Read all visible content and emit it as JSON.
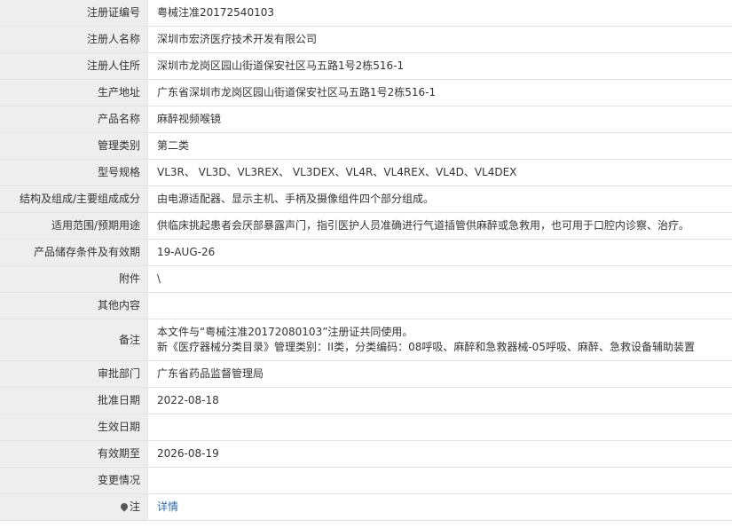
{
  "rows": [
    {
      "label": "注册证编号",
      "value": "粤械注准20172540103"
    },
    {
      "label": "注册人名称",
      "value": "深圳市宏济医疗技术开发有限公司"
    },
    {
      "label": "注册人住所",
      "value": "深圳市龙岗区园山街道保安社区马五路1号2栋516-1"
    },
    {
      "label": "生产地址",
      "value": "广东省深圳市龙岗区园山街道保安社区马五路1号2栋516-1"
    },
    {
      "label": "产品名称",
      "value": "麻醉视频喉镜"
    },
    {
      "label": "管理类别",
      "value": "第二类"
    },
    {
      "label": "型号规格",
      "value": "VL3R、 VL3D、VL3REX、 VL3DEX、VL4R、VL4REX、VL4D、VL4DEX"
    },
    {
      "label": "结构及组成/主要组成成分",
      "value": "由电源适配器、显示主机、手柄及摄像组件四个部分组成。"
    },
    {
      "label": "适用范围/预期用途",
      "value": "供临床挑起患者会厌部暴露声门，指引医护人员准确进行气道插管供麻醉或急救用，也可用于口腔内诊察、治疗。"
    },
    {
      "label": "产品储存条件及有效期",
      "value": "19-AUG-26"
    },
    {
      "label": "附件",
      "value": "\\"
    },
    {
      "label": "其他内容",
      "value": ""
    }
  ],
  "remark": {
    "label": "备注",
    "line1": "本文件与“粤械注准20172080103”注册证共同使用。",
    "line2": "新《医疗器械分类目录》管理类别：II类，分类编码：08呼吸、麻醉和急救器械-05呼吸、麻醉、急救设备辅助装置"
  },
  "rows2": [
    {
      "label": "审批部门",
      "value": "广东省药品监督管理局"
    },
    {
      "label": "批准日期",
      "value": "2022-08-18"
    },
    {
      "label": "生效日期",
      "value": ""
    },
    {
      "label": "有效期至",
      "value": "2026-08-19"
    },
    {
      "label": "变更情况",
      "value": ""
    }
  ],
  "note": {
    "icon": "location-pin-icon",
    "label": "注",
    "link_text": "详情"
  }
}
